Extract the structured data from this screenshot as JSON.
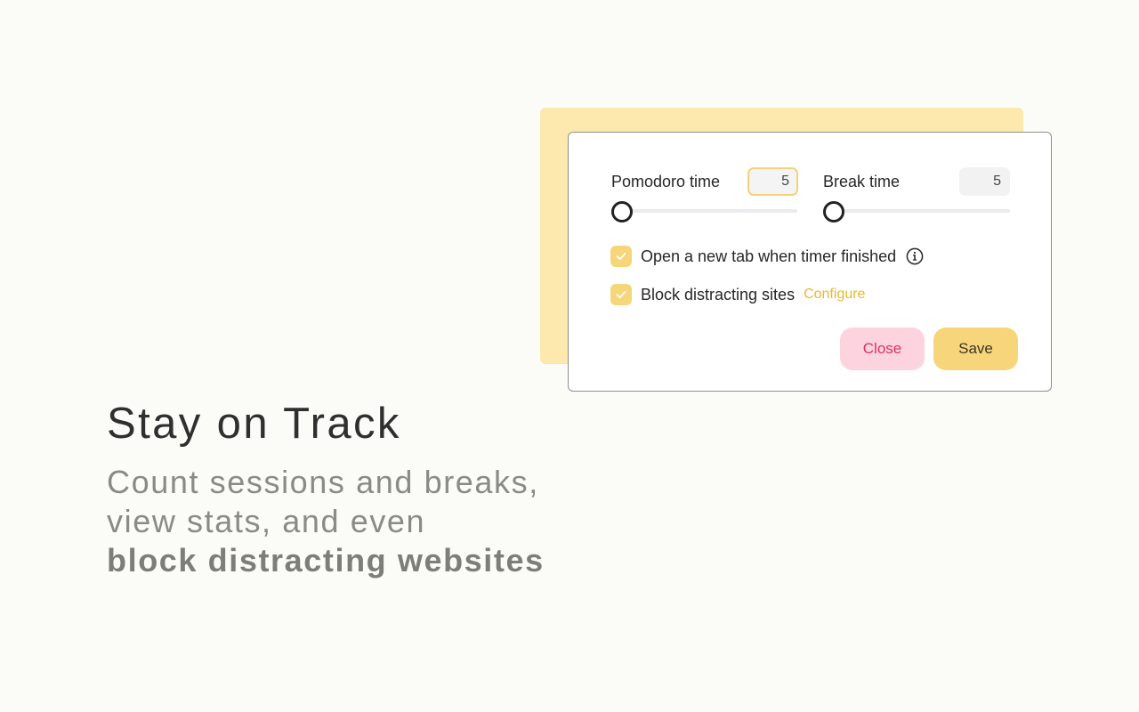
{
  "hero": {
    "title": "Stay on Track",
    "subtitle_line1": "Count sessions and breaks,",
    "subtitle_line2": "view stats, and even",
    "subtitle_bold": "block distracting websites"
  },
  "settings": {
    "pomodoro": {
      "label": "Pomodoro time",
      "value": "5",
      "slider_fraction": 0
    },
    "break": {
      "label": "Break time",
      "value": "5",
      "slider_fraction": 0
    },
    "open_new_tab": {
      "label": "Open a new tab when timer finished",
      "checked": true,
      "icon": "info-icon"
    },
    "block_sites": {
      "label": "Block distracting sites",
      "checked": true,
      "link": "Configure"
    },
    "buttons": {
      "close": "Close",
      "save": "Save"
    }
  },
  "colors": {
    "background": "#fbfcf7",
    "accent_yellow": "#f7d67b",
    "back_card": "#fde8ad",
    "close_bg": "#fdd3df",
    "close_text": "#d6345f",
    "link": "#e9b92d"
  }
}
